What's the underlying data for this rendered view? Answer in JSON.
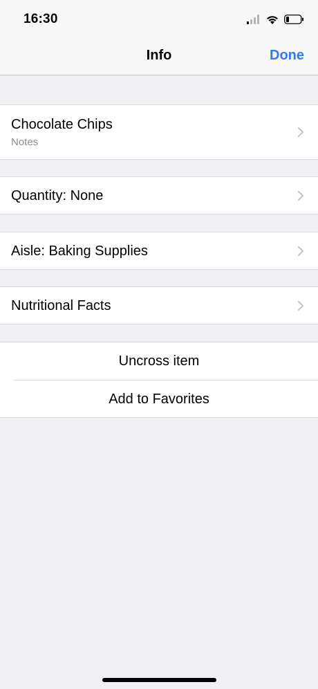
{
  "status_bar": {
    "time": "16:30"
  },
  "nav": {
    "title": "Info",
    "done_label": "Done"
  },
  "item": {
    "name": "Chocolate Chips",
    "notes_placeholder": "Notes"
  },
  "rows": {
    "quantity": "Quantity: None",
    "aisle": "Aisle: Baking Supplies",
    "nutrition": "Nutritional Facts"
  },
  "actions": {
    "uncross": "Uncross item",
    "favorite": "Add to Favorites"
  },
  "colors": {
    "accent": "#3478f6",
    "background": "#efeff4",
    "secondary_text": "#8e8e93",
    "chevron": "#c4c4c9"
  },
  "icons": [
    "signal-icon",
    "wifi-icon",
    "battery-icon",
    "chevron-right-icon"
  ]
}
